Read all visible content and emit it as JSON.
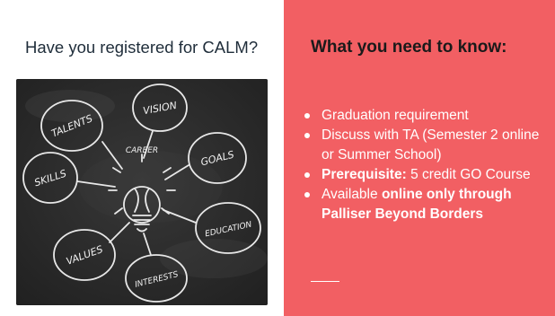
{
  "colors": {
    "right_panel": "#f25f63",
    "left_title": "#1f2d3a",
    "chalkboard": "#2b2b2b"
  },
  "left": {
    "title": "Have you registered for CALM?",
    "board_words": {
      "talents": "TALENTS",
      "vision": "VISION",
      "goals": "GOALS",
      "career": "CAREER",
      "skills": "SKILLS",
      "education": "EDUCATION",
      "values": "VALUES",
      "interests": "INTERESTS"
    }
  },
  "right": {
    "title": "What you need to know:",
    "bullets": {
      "b1": "Graduation requirement",
      "b2": "Discuss with TA (Semester 2 online or Summer School)",
      "b3_label": "Prerequisite:",
      "b3_text": "5 credit GO Course",
      "b4_text": "Available",
      "b4_bold": "online only through Palliser Beyond Borders"
    }
  }
}
